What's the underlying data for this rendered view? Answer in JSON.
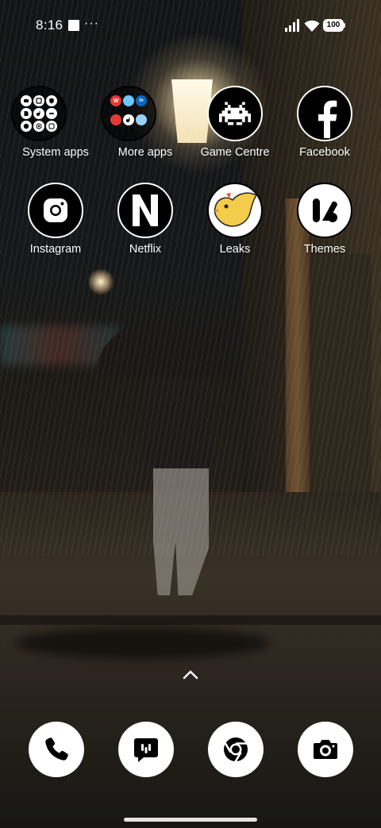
{
  "status_bar": {
    "time": "8:16",
    "overflow": "···",
    "battery": "100"
  },
  "apps": [
    {
      "label": "System apps",
      "icon": "folder-icon"
    },
    {
      "label": "More apps",
      "icon": "folder-icon"
    },
    {
      "label": "Game Centre",
      "icon": "space-invader-icon"
    },
    {
      "label": "Facebook",
      "icon": "facebook-icon"
    },
    {
      "label": "Instagram",
      "icon": "instagram-icon"
    },
    {
      "label": "Netflix",
      "icon": "netflix-icon"
    },
    {
      "label": "Leaks",
      "icon": "bird-icon"
    },
    {
      "label": "Themes",
      "icon": "themes-icon"
    }
  ],
  "more_apps_folder": {
    "mini_labels": [
      "W",
      "in"
    ]
  },
  "dock": [
    {
      "icon": "phone-icon"
    },
    {
      "icon": "messages-icon"
    },
    {
      "icon": "chrome-icon"
    },
    {
      "icon": "camera-icon"
    }
  ],
  "colors": {
    "icon_dark": "#000000",
    "icon_light": "#ffffff",
    "leaks_yellow": "#f2cc4a"
  }
}
